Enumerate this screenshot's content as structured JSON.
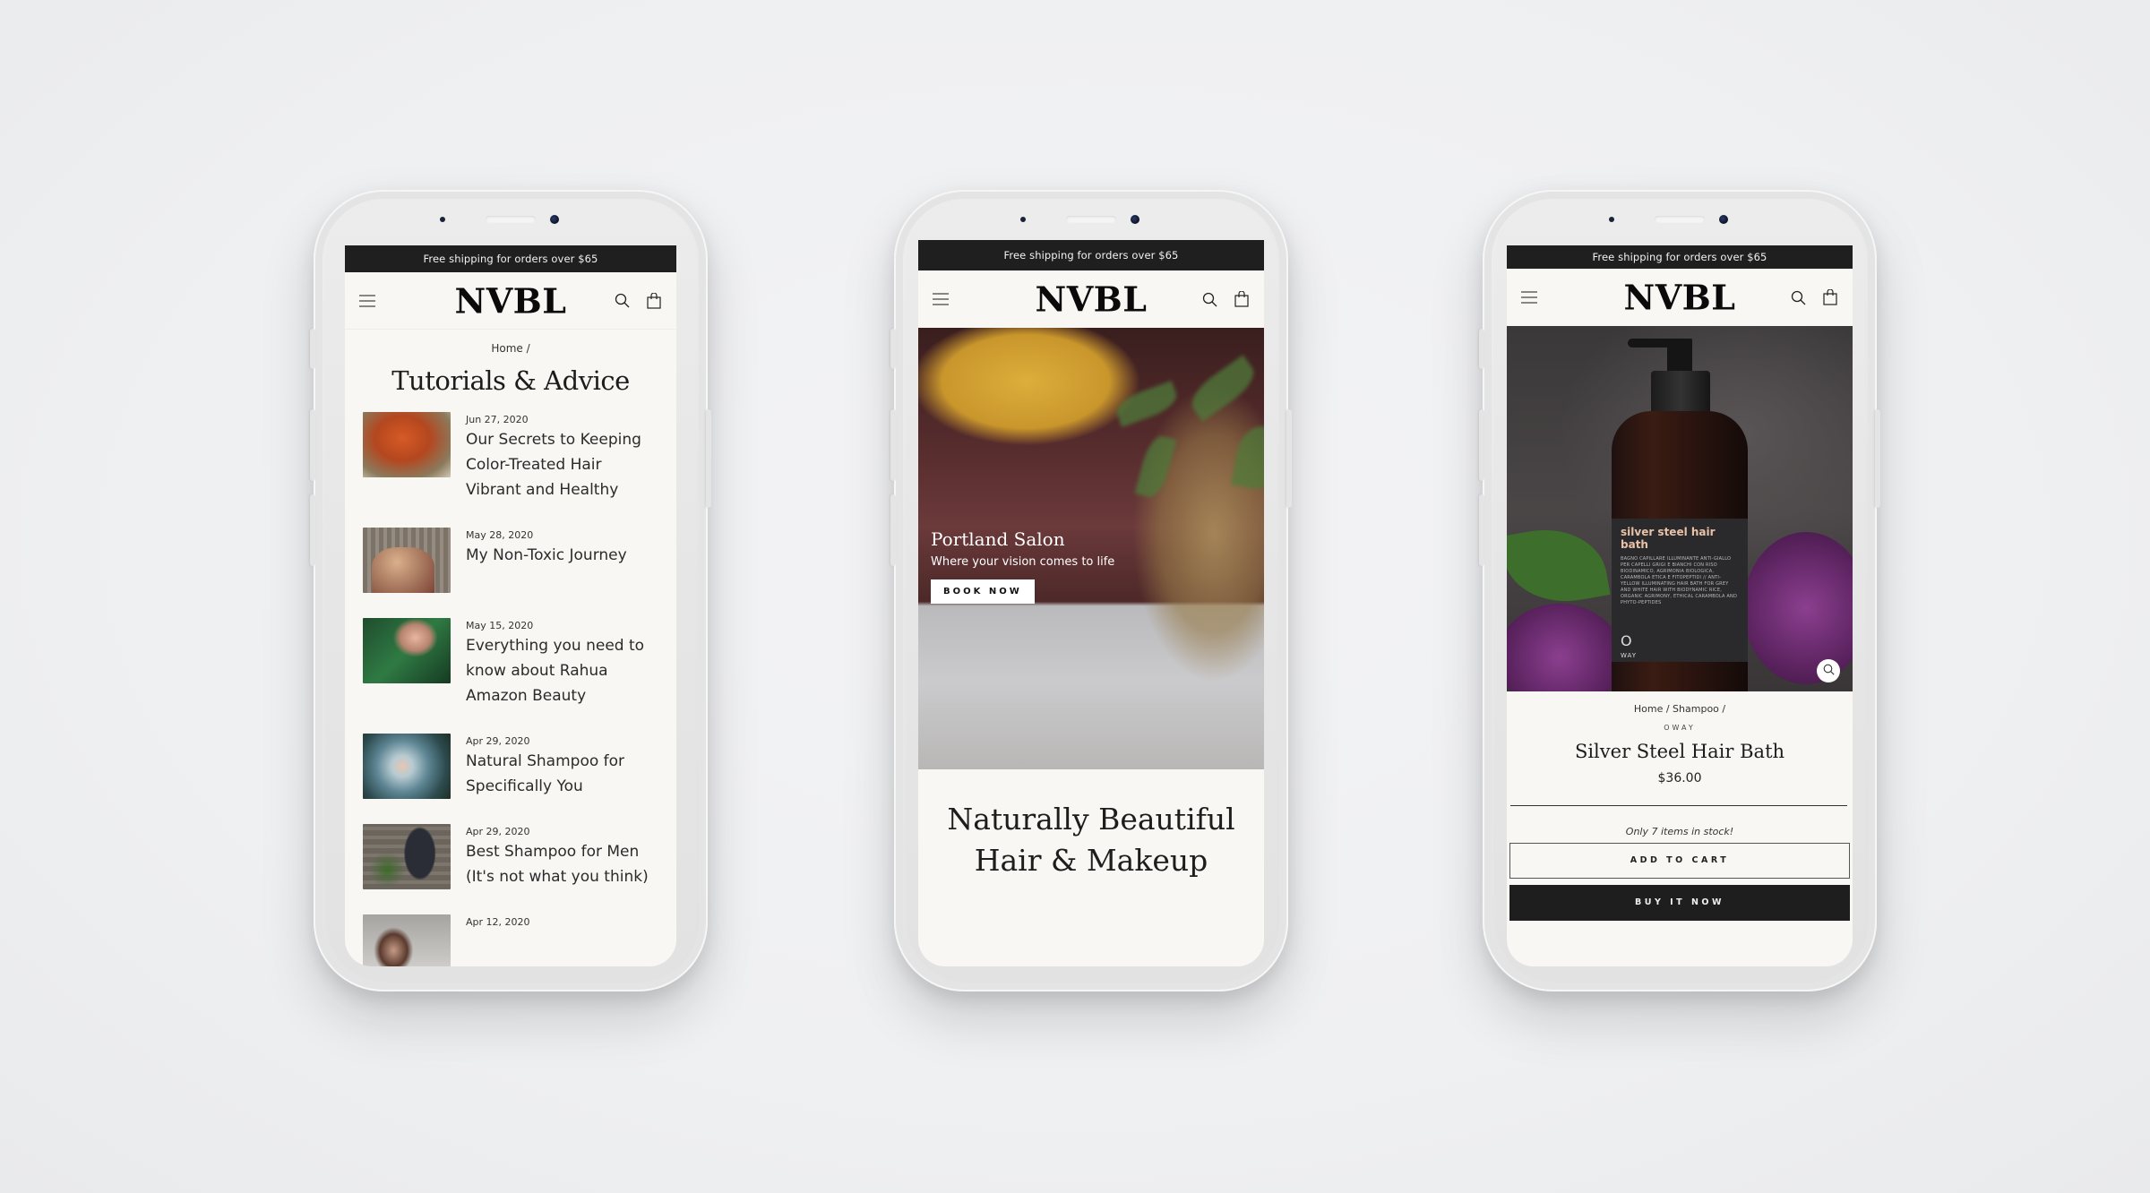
{
  "store": {
    "brand": "NVBL",
    "announcement": "Free shipping for orders over $65",
    "header_icons": [
      "menu-icon",
      "search-icon",
      "cart-icon"
    ]
  },
  "blog_page": {
    "breadcrumb": "Home /",
    "title": "Tutorials & Advice",
    "articles": [
      {
        "date": "Jun 27, 2020",
        "title": "Our Secrets to Keeping Color-Treated Hair Vibrant and Healthy",
        "thumb_color": "#b7552b"
      },
      {
        "date": "May 28, 2020",
        "title": "My Non-Toxic Journey",
        "thumb_color": "#8a7a68"
      },
      {
        "date": "May 15, 2020",
        "title": "Everything you need to know about Rahua Amazon Beauty",
        "thumb_color": "#2a5a36"
      },
      {
        "date": "Apr 29, 2020",
        "title": "Natural Shampoo for Specifically You",
        "thumb_color": "#3e6570"
      },
      {
        "date": "Apr 29, 2020",
        "title": "Best Shampoo for Men (It's not what you think)",
        "thumb_color": "#6a645c"
      },
      {
        "date": "Apr 12, 2020",
        "title": "",
        "thumb_color": "#8c8884"
      }
    ]
  },
  "home_page": {
    "hero": {
      "title": "Portland Salon",
      "subtitle": "Where your vision comes to life",
      "button": "BOOK NOW"
    },
    "tagline_line1": "Naturally Beautiful",
    "tagline_line2": "Hair & Makeup"
  },
  "product_page": {
    "image_label": {
      "name": "silver steel hair bath",
      "text": "BAGNO CAPILLARE ILLUMINANTE ANTI-GIALLO PER CAPELLI GRIGI E BIANCHI CON RISO BIODINAMICO, AGRIMONIA BIOLOGICA, CARAMBOLA ETICA E FITOPEPTIDI // ANTI-YELLOW ILLUMINATING HAIR BATH FOR GREY AND WHITE HAIR WITH BIODYNAMIC RICE, ORGANIC AGRIMONY, ETHICAL CARAMBOLA AND PHYTO-PEPTIDES",
      "logo_mark": "O",
      "logo_text": "WAY"
    },
    "breadcrumb": "Home / Shampoo /",
    "vendor": "OWAY",
    "title": "Silver Steel Hair Bath",
    "price": "$36.00",
    "stock_note": "Only 7 items in stock!",
    "add_to_cart": "ADD TO CART",
    "buy_now": "BUY IT NOW"
  }
}
